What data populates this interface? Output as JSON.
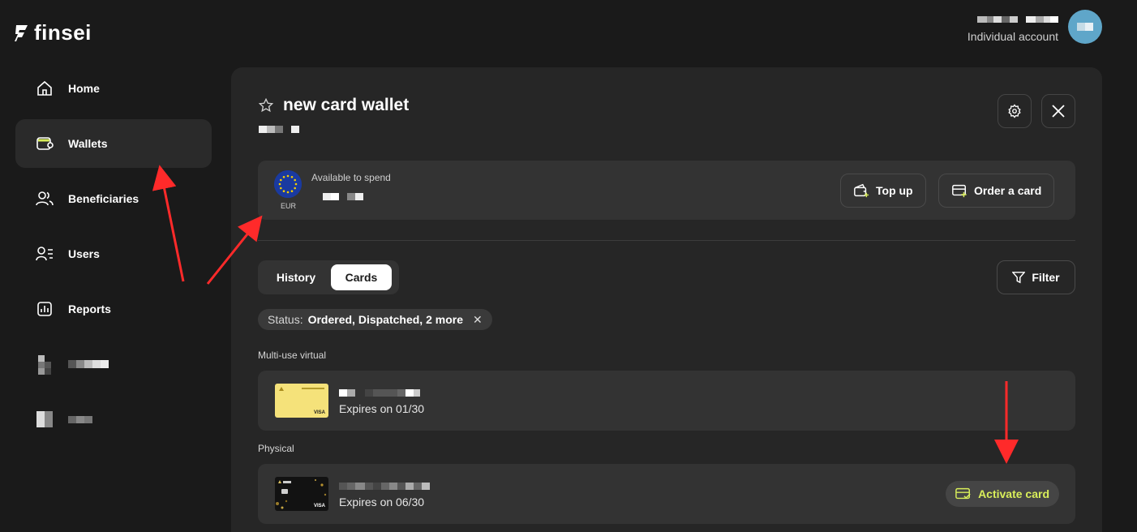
{
  "brand": {
    "name": "finsei"
  },
  "account": {
    "type_label": "Individual account"
  },
  "sidebar": {
    "items": [
      {
        "label": "Home",
        "icon": "home-icon",
        "active": false
      },
      {
        "label": "Wallets",
        "icon": "wallet-icon",
        "active": true
      },
      {
        "label": "Beneficiaries",
        "icon": "users-icon",
        "active": false
      },
      {
        "label": "Users",
        "icon": "user-list-icon",
        "active": false
      },
      {
        "label": "Reports",
        "icon": "report-icon",
        "active": false
      }
    ]
  },
  "wallet": {
    "title": "new card wallet",
    "currency_code": "EUR",
    "available_label": "Available to spend",
    "top_up_label": "Top up",
    "order_card_label": "Order a card"
  },
  "tabs": {
    "history": "History",
    "cards": "Cards",
    "active": "Cards"
  },
  "filter": {
    "label": "Filter"
  },
  "status_chip": {
    "key": "Status:",
    "value": "Ordered, Dispatched, 2 more"
  },
  "sections": [
    {
      "label": "Multi-use virtual",
      "cards": [
        {
          "expires": "Expires on 01/30",
          "network": "VISA",
          "style": "yellow"
        }
      ]
    },
    {
      "label": "Physical",
      "cards": [
        {
          "expires": "Expires on 06/30",
          "network": "VISA",
          "style": "black",
          "action": "Activate card"
        }
      ]
    }
  ],
  "colors": {
    "background": "#1a1a1a",
    "panel": "#262626",
    "accent": "#d9ee5a",
    "avatar": "#5fa6c9",
    "annotation_arrow": "#ff2a2a"
  }
}
